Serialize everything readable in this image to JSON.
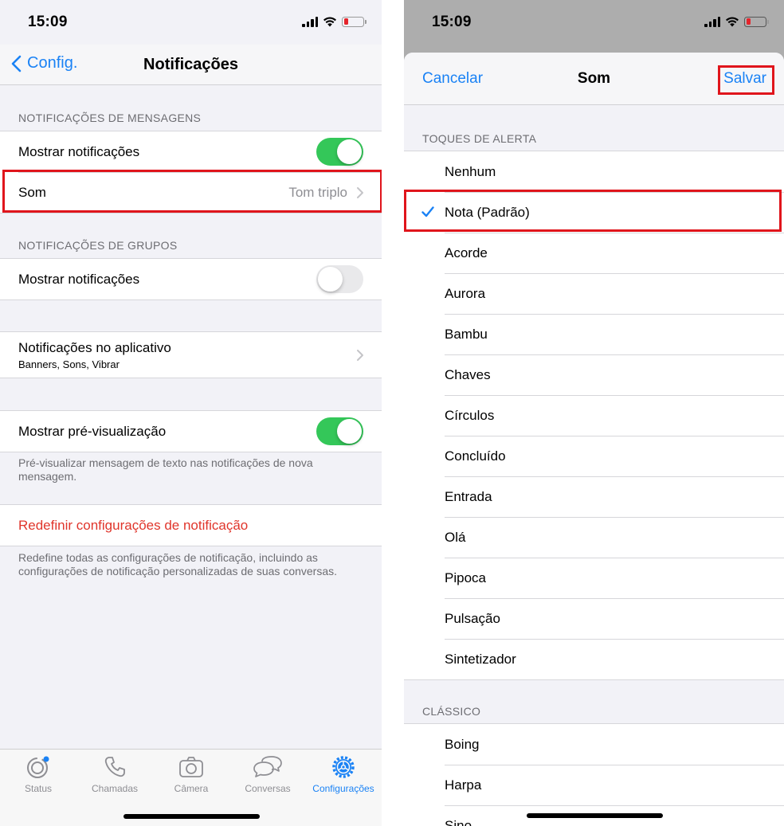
{
  "status_bar": {
    "time": "15:09"
  },
  "left": {
    "nav": {
      "back_label": "Config.",
      "title": "Notificações"
    },
    "message_section": {
      "header": "NOTIFICAÇÕES DE MENSAGENS",
      "show_label": "Mostrar notificações",
      "show_on": true,
      "sound_label": "Som",
      "sound_value": "Tom triplo"
    },
    "group_section": {
      "header": "NOTIFICAÇÕES DE GRUPOS",
      "show_label": "Mostrar notificações",
      "show_on": false
    },
    "in_app": {
      "label": "Notificações no aplicativo",
      "sublabel": "Banners, Sons, Vibrar"
    },
    "preview": {
      "label": "Mostrar pré-visualização",
      "on": true,
      "note": "Pré-visualizar mensagem de texto nas notificações de nova mensagem."
    },
    "reset": {
      "label": "Redefinir configurações de notificação",
      "note": "Redefine todas as configurações de notificação, incluindo as configurações de notificação personalizadas de suas conversas."
    },
    "tabbar": [
      {
        "label": "Status",
        "icon": "status-icon"
      },
      {
        "label": "Chamadas",
        "icon": "phone-icon"
      },
      {
        "label": "Câmera",
        "icon": "camera-icon"
      },
      {
        "label": "Conversas",
        "icon": "chat-bubbles-icon"
      },
      {
        "label": "Configurações",
        "icon": "gear-icon",
        "active": true
      }
    ]
  },
  "right": {
    "sheet_nav": {
      "cancel": "Cancelar",
      "title": "Som",
      "save": "Salvar"
    },
    "alert_tones_header": "TOQUES DE ALERTA",
    "alert_tones": [
      "Nenhum",
      "Nota (Padrão)",
      "Acorde",
      "Aurora",
      "Bambu",
      "Chaves",
      "Círculos",
      "Concluído",
      "Entrada",
      "Olá",
      "Pipoca",
      "Pulsação",
      "Sintetizador"
    ],
    "selected_tone": "Nota (Padrão)",
    "classic_header": "CLÁSSICO",
    "classic_tones": [
      "Boing",
      "Harpa",
      "Sino"
    ]
  },
  "colors": {
    "accent": "#1a82f5",
    "toggle_on": "#34c759",
    "destructive": "#e0352b",
    "highlight_box": "#e0151c"
  }
}
